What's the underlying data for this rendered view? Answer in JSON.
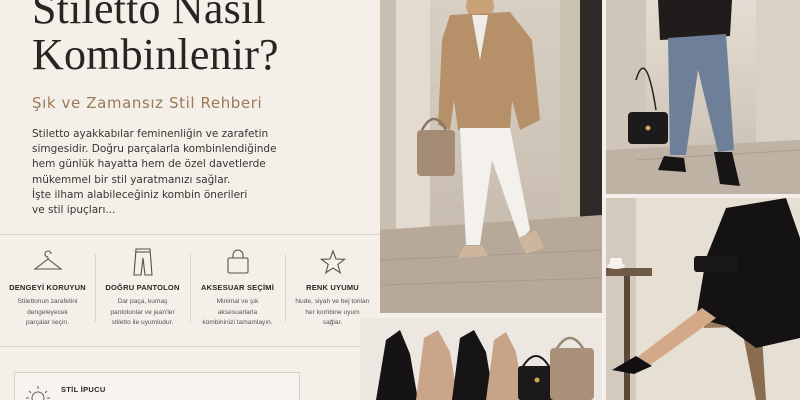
{
  "header": {
    "title_line1": "Stiletto Nasıl",
    "title_line2": "Kombinlenir?",
    "subtitle": "Şık ve Zamansız Stil Rehberi"
  },
  "intro": {
    "lines": [
      "Stiletto ayakkabılar feminenliğin ve zarafetin",
      "simgesidir. Doğru parçalarla kombinlendiğinde",
      "hem günlük hayatta hem de özel davetlerde",
      "mükemmel bir stil yaratmanızı sağlar.",
      "İşte ilham alabileceğiniz kombin önerileri",
      "ve stil ipuçları..."
    ]
  },
  "features": [
    {
      "icon": "hanger-icon",
      "title": "DENGEYİ KORUYUN",
      "desc": [
        "Stilettonun zarafetini",
        "dengeleyecek",
        "parçalar seçin."
      ]
    },
    {
      "icon": "trousers-icon",
      "title": "DOĞRU PANTOLON",
      "desc": [
        "Dar paça, kumaş",
        "pantolonlar ve jean'ler",
        "stiletto ile uyumludur."
      ]
    },
    {
      "icon": "handbag-icon",
      "title": "AKSESUAR SEÇİMİ",
      "desc": [
        "Minimal ve şık",
        "aksesuarlarla",
        "kombininizi tamamlayın."
      ]
    },
    {
      "icon": "star-icon",
      "title": "RENK UYUMU",
      "desc": [
        "Nude, siyah ve bej tonları",
        "her kombine uyum",
        "sağlar."
      ]
    }
  ],
  "tip": {
    "label": "STİL İPUCU",
    "icon": "lightbulb-icon"
  },
  "colors": {
    "accent": "#9a7a58",
    "background": "#f4efe9",
    "text": "#2b2623"
  }
}
